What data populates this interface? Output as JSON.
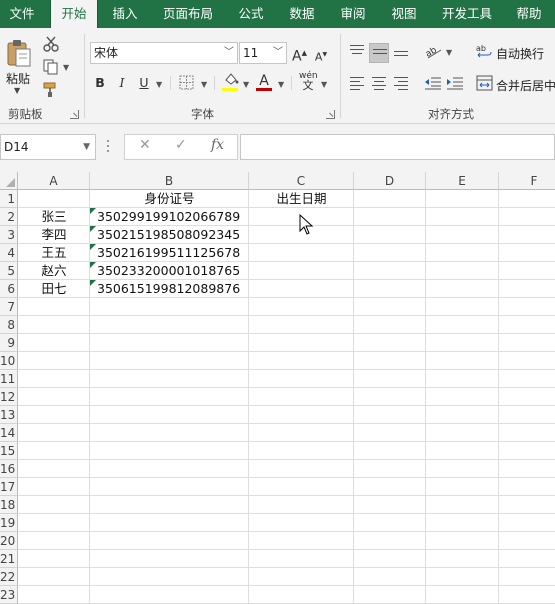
{
  "ribbon": {
    "tabs": [
      {
        "label": "文件",
        "active": false
      },
      {
        "label": "开始",
        "active": true
      },
      {
        "label": "插入",
        "active": false
      },
      {
        "label": "页面布局",
        "active": false
      },
      {
        "label": "公式",
        "active": false
      },
      {
        "label": "数据",
        "active": false
      },
      {
        "label": "审阅",
        "active": false
      },
      {
        "label": "视图",
        "active": false
      },
      {
        "label": "开发工具",
        "active": false
      },
      {
        "label": "帮助",
        "active": false
      }
    ],
    "clipboard": {
      "group_label": "剪贴板",
      "paste_label": "粘贴"
    },
    "font": {
      "group_label": "字体",
      "font_name": "宋体",
      "font_size": "11",
      "bold": "B",
      "italic": "I",
      "underline": "U",
      "grow": "A",
      "shrink": "A",
      "font_color_letter": "A",
      "phonetic": "wén"
    },
    "alignment": {
      "group_label": "对齐方式",
      "wrap_text": "自动换行",
      "merge_center": "合并后居中"
    },
    "colors": {
      "brand": "#217346",
      "fill_color": "#ffff00",
      "font_color": "#c00000"
    }
  },
  "formula_bar": {
    "name_box": "D14",
    "fx": "fx",
    "formula": ""
  },
  "sheet": {
    "columns": [
      "A",
      "B",
      "C",
      "D",
      "E",
      "F"
    ],
    "rows": [
      "1",
      "2",
      "3",
      "4",
      "5",
      "6",
      "7",
      "8",
      "9",
      "10",
      "11",
      "12",
      "13",
      "14",
      "15",
      "16",
      "17",
      "18",
      "19",
      "20",
      "21",
      "22",
      "23"
    ],
    "header_row": {
      "A": "",
      "B": "身份证号",
      "C": "出生日期"
    },
    "data": [
      {
        "name": "张三",
        "id": "350299199102066789"
      },
      {
        "name": "李四",
        "id": "350215198508092345"
      },
      {
        "name": "王五",
        "id": "350216199511125678"
      },
      {
        "name": "赵六",
        "id": "350233200001018765"
      },
      {
        "name": "田七",
        "id": "350615199812089876"
      }
    ]
  }
}
